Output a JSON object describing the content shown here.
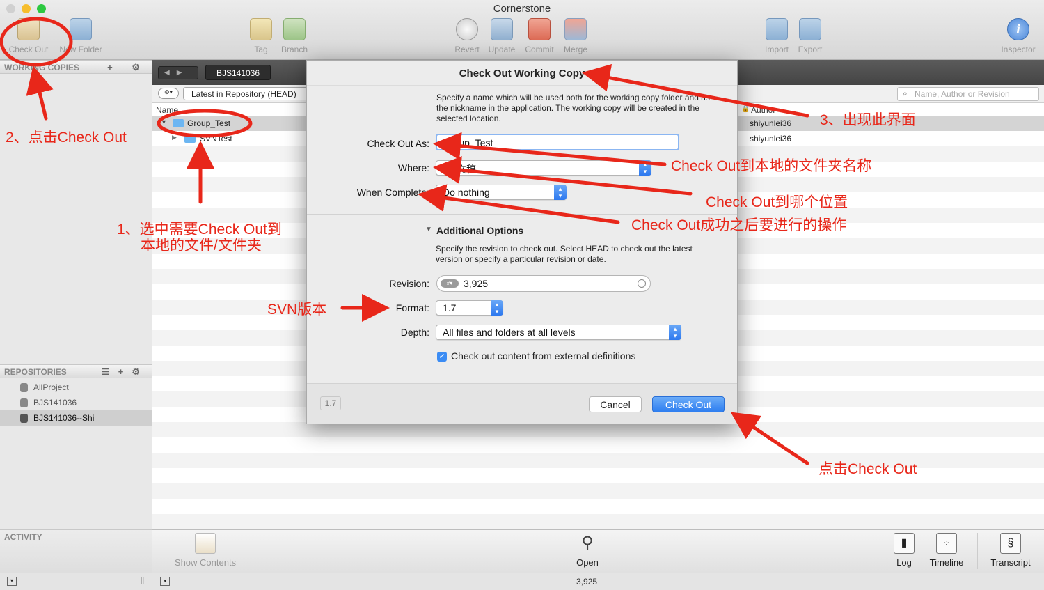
{
  "window": {
    "title": "Cornerstone"
  },
  "toolbar": {
    "buttons": [
      {
        "label": "Check Out",
        "icon": "check-out-icon"
      },
      {
        "label": "New Folder",
        "icon": "new-folder-icon"
      },
      {
        "label": "Tag",
        "icon": "tag-icon"
      },
      {
        "label": "Branch",
        "icon": "branch-icon"
      },
      {
        "label": "Revert",
        "icon": "revert-icon"
      },
      {
        "label": "Update",
        "icon": "update-icon"
      },
      {
        "label": "Commit",
        "icon": "commit-icon"
      },
      {
        "label": "Merge",
        "icon": "merge-icon"
      },
      {
        "label": "Import",
        "icon": "import-icon"
      },
      {
        "label": "Export",
        "icon": "export-icon"
      },
      {
        "label": "Inspector",
        "icon": "info-icon"
      }
    ]
  },
  "sidebar": {
    "working_copies_header": "WORKING COPIES",
    "repositories_header": "REPOSITORIES",
    "repositories": [
      "AllProject",
      "BJS141036",
      "BJS141036--Shi"
    ],
    "activity_header": "ACTIVITY"
  },
  "main": {
    "breadcrumb": "BJS141036",
    "filter_mode": "Latest in Repository (HEAD)",
    "search_placeholder": "Name, Author or Revision",
    "name_column": "Name",
    "author_column": "Author",
    "tree": [
      {
        "name": "Group_Test",
        "author": "shiyunlei36"
      },
      {
        "name": "SVNTest",
        "author": "shiyunlei36"
      }
    ]
  },
  "dialog": {
    "title": "Check Out Working Copy",
    "description": "Specify a name which will be used both for the working copy folder and as the nickname in the application. The working copy will be created in the selected location.",
    "check_out_as_label": "Check Out As:",
    "check_out_as_value": "Group_Test",
    "where_label": "Where:",
    "where_value": "文稿",
    "when_complete_label": "When Complete:",
    "when_complete_value": "Do nothing",
    "additional_options": "Additional Options",
    "options_description": "Specify the revision to check out. Select HEAD to check out the latest version or specify a particular revision or date.",
    "revision_label": "Revision:",
    "revision_value": "3,925",
    "format_label": "Format:",
    "format_value": "1.7",
    "depth_label": "Depth:",
    "depth_value": "All files and folders at all levels",
    "externals_label": "Check out content from external definitions",
    "externals_checked": true,
    "version_badge": "1.7",
    "cancel_label": "Cancel",
    "checkout_label": "Check Out"
  },
  "bottom": {
    "show_contents": "Show Contents",
    "open": "Open",
    "log": "Log",
    "timeline": "Timeline",
    "transcript": "Transcript",
    "revision": "3,925"
  },
  "annotations": {
    "step1_line1": "1、选中需要Check Out到",
    "step1_line2": "本地的文件/文件夹",
    "step2": "2、点击Check Out",
    "step3": "3、出现此界面",
    "name_note": "Check Out到本地的文件夹名称",
    "where_note": "Check Out到哪个位置",
    "after_note": "Check Out成功之后要进行的操作",
    "svn_note": "SVN版本",
    "click_note": "点击Check Out"
  },
  "colors": {
    "annotation_red": "#e8271a",
    "accent_blue": "#3b8cf4"
  }
}
